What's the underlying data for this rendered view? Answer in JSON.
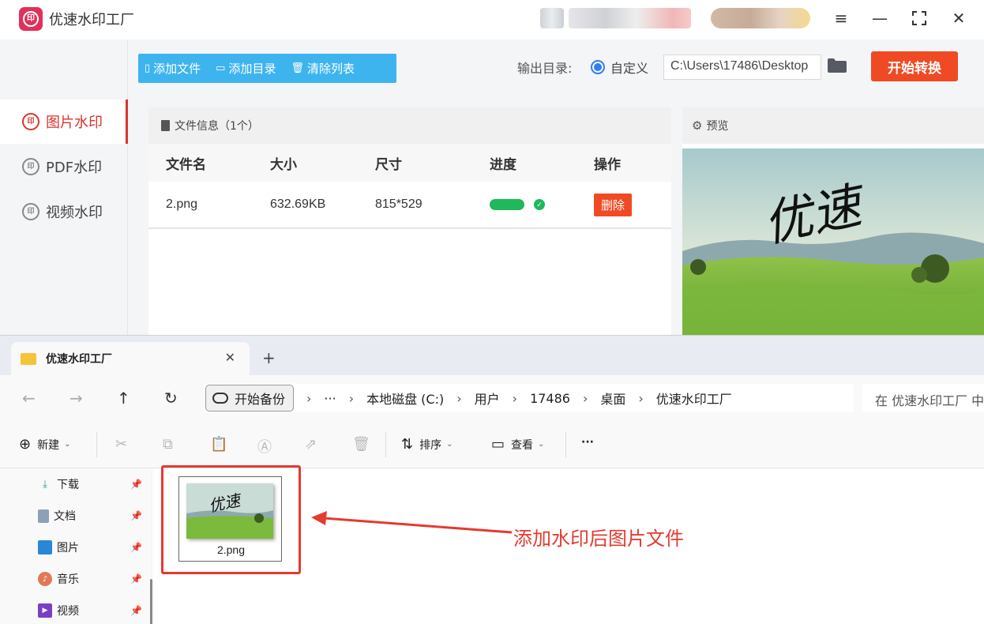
{
  "app": {
    "title": "优速水印工厂",
    "sidebar": [
      {
        "label": "图片水印",
        "icon": "watermark-icon",
        "active": true
      },
      {
        "label": "PDF水印",
        "icon": "watermark-icon",
        "active": false
      },
      {
        "label": "视频水印",
        "icon": "watermark-icon",
        "active": false
      }
    ],
    "toolbar": {
      "add_file": "添加文件",
      "add_folder": "添加目录",
      "clear_list": "清除列表"
    },
    "output": {
      "label": "输出目录:",
      "option": "自定义",
      "path": "C:\\Users\\17486\\Desktop"
    },
    "start_button": "开始转换",
    "file_panel": {
      "header": "文件信息（1个）",
      "columns": [
        "文件名",
        "大小",
        "尺寸",
        "进度",
        "操作"
      ],
      "rows": [
        {
          "name": "2.png",
          "size": "632.69KB",
          "dimensions": "815*529",
          "progress": 1.0,
          "action": "删除"
        }
      ]
    },
    "preview": {
      "header": "预览",
      "watermark_text": "优速"
    }
  },
  "explorer": {
    "tab_title": "优速水印工厂",
    "new_tab": "+",
    "close": "✕",
    "backup": "开始备份",
    "more_crumb": "···",
    "breadcrumbs": [
      "本地磁盘 (C:)",
      "用户",
      "17486",
      "桌面",
      "优速水印工厂"
    ],
    "search_placeholder": "在 优速水印工厂 中",
    "commands": {
      "new": "新建",
      "sort": "排序",
      "view": "查看",
      "more": "···"
    },
    "nav_items": [
      {
        "label": "下载",
        "icon": "download-icon"
      },
      {
        "label": "文档",
        "icon": "document-icon"
      },
      {
        "label": "图片",
        "icon": "pictures-icon"
      },
      {
        "label": "音乐",
        "icon": "music-icon"
      },
      {
        "label": "视频",
        "icon": "video-icon"
      }
    ],
    "files": [
      {
        "name": "2.png"
      }
    ]
  },
  "annotation": {
    "text": "添加水印后图片文件",
    "color": "#e53a2f"
  }
}
